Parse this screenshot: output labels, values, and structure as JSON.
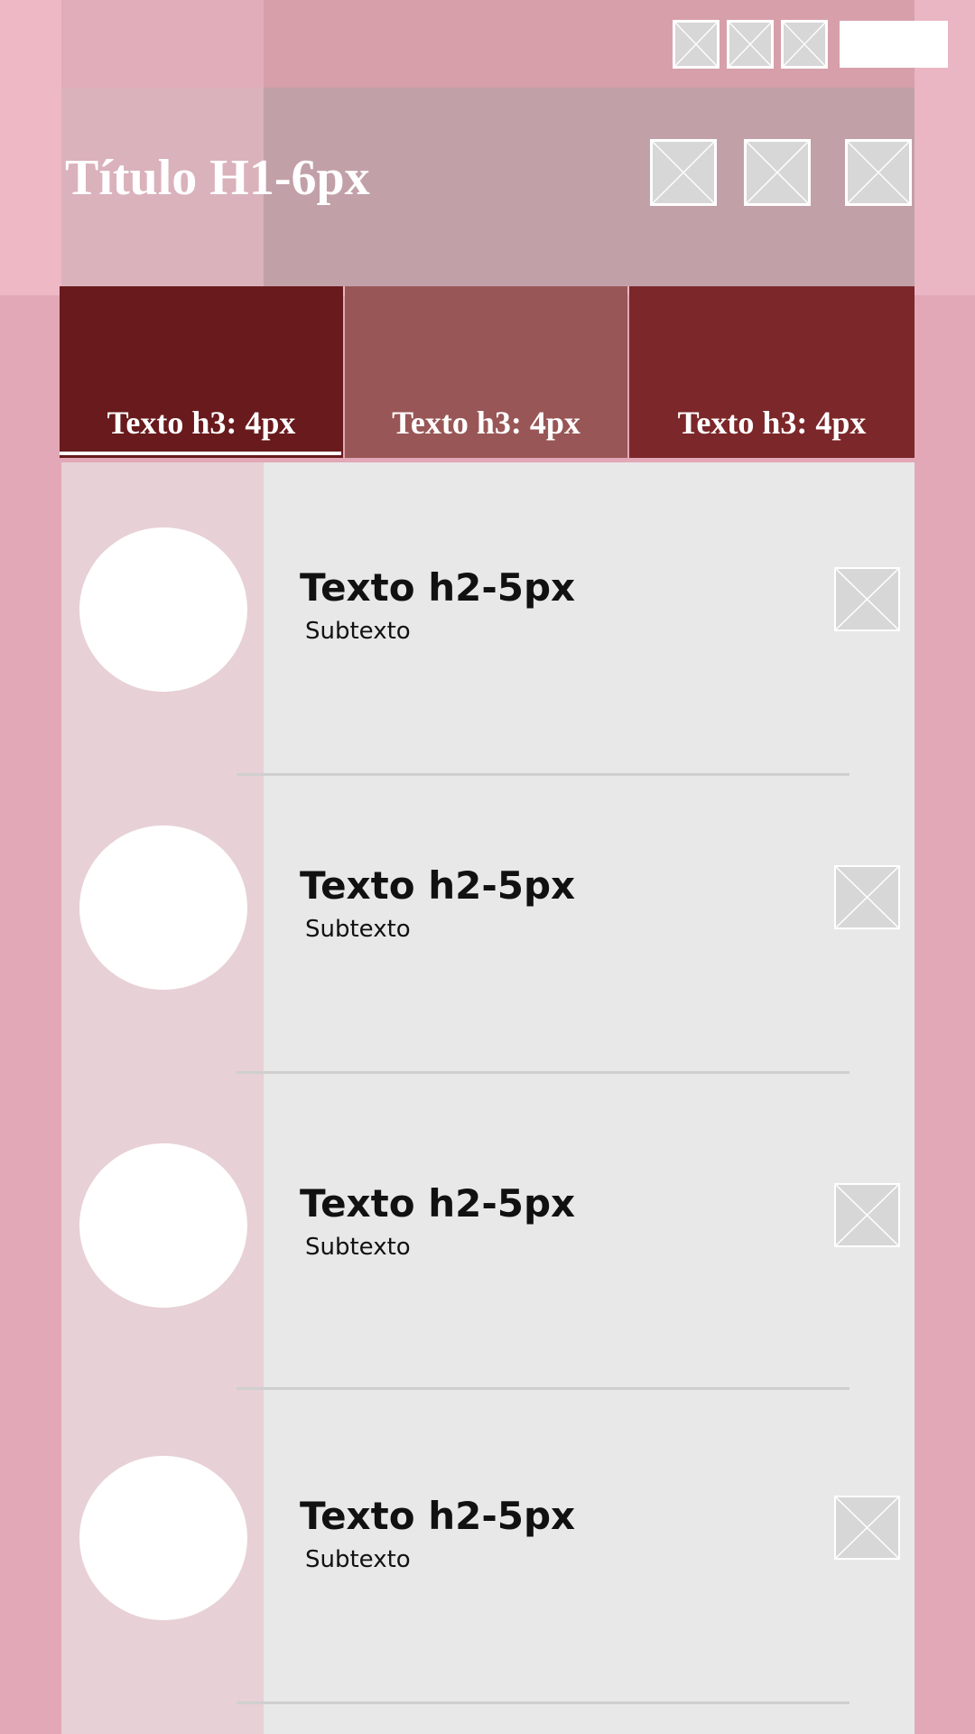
{
  "header": {
    "title": "Título H1-6px",
    "status_icons": [
      "image-placeholder-icon",
      "image-placeholder-icon",
      "image-placeholder-icon"
    ],
    "action_icons": [
      "image-placeholder-icon",
      "image-placeholder-icon",
      "image-placeholder-icon"
    ]
  },
  "tabs": [
    {
      "label": "Texto h3: 4px",
      "selected": true
    },
    {
      "label": "Texto h3: 4px",
      "selected": false
    },
    {
      "label": "Texto h3: 4px",
      "selected": false
    }
  ],
  "list": {
    "items": [
      {
        "title": "Texto h2-5px",
        "subtitle": "Subtexto"
      },
      {
        "title": "Texto h2-5px",
        "subtitle": "Subtexto"
      },
      {
        "title": "Texto h2-5px",
        "subtitle": "Subtexto"
      },
      {
        "title": "Texto h2-5px",
        "subtitle": "Subtexto"
      }
    ]
  },
  "colors": {
    "tab_selected": "#681a1c",
    "tab_middle": "#995656",
    "tab_right": "#7c272a",
    "header": "#c2a0a8",
    "list_bg": "#e8e8e8"
  }
}
